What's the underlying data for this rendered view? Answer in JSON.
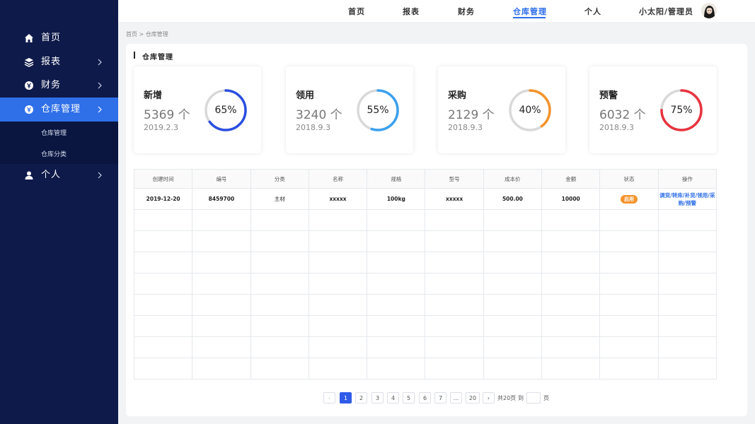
{
  "sidebar": {
    "items": [
      {
        "label": "首页",
        "icon": "home-icon"
      },
      {
        "label": "报表",
        "icon": "layers-icon"
      },
      {
        "label": "财务",
        "icon": "yen-icon"
      },
      {
        "label": "仓库管理",
        "icon": "yen-icon"
      },
      {
        "label": "个人",
        "icon": "user-icon"
      }
    ],
    "sub_items": [
      {
        "label": "仓库管理"
      },
      {
        "label": "仓库分类"
      }
    ],
    "active_color": "#2f6fe8",
    "bg_color": "#0e1a4a"
  },
  "topnav": {
    "links": [
      "首页",
      "报表",
      "财务",
      "仓库管理",
      "个人"
    ],
    "active": "仓库管理",
    "user": "小太阳/管理员"
  },
  "breadcrumb": "首页 > 仓库管理",
  "section_title": "仓库管理",
  "cards": [
    {
      "title": "新增",
      "value": "5369 个",
      "date": "2019.2.3",
      "percent_label": "65%",
      "percent": 0.65,
      "color": "#2a4fe0"
    },
    {
      "title": "领用",
      "value": "3240 个",
      "date": "2018.9.3",
      "percent_label": "55%",
      "percent": 0.55,
      "color": "#3aa1f0"
    },
    {
      "title": "采购",
      "value": "2129 个",
      "date": "2018.9.3",
      "percent_label": "40%",
      "percent": 0.4,
      "color": "#f5932b"
    },
    {
      "title": "预警",
      "value": "6032 个",
      "date": "2018.9.3",
      "percent_label": "75%",
      "percent": 0.75,
      "color": "#e8333f"
    }
  ],
  "table": {
    "headers": [
      "创建时间",
      "编号",
      "分类",
      "名称",
      "规格",
      "型号",
      "成本价",
      "金额",
      "状态",
      "操作"
    ],
    "rows": [
      {
        "created": "2019-12-20",
        "code": "8459700",
        "category": "主材",
        "name": "xxxxx",
        "spec": "100kg",
        "model": "xxxxx",
        "cost": "500.00",
        "amount": "10000",
        "status": "启用",
        "ops": "调货/转库/补货/领用/采购/预警"
      }
    ],
    "empty_rows": 8
  },
  "pagination": {
    "prev": "‹",
    "pages": [
      "1",
      "2",
      "3",
      "4",
      "5",
      "6",
      "7",
      "...",
      "20"
    ],
    "current": "1",
    "next": "›",
    "total": "共20页",
    "goto": "到",
    "page_unit": "页"
  }
}
